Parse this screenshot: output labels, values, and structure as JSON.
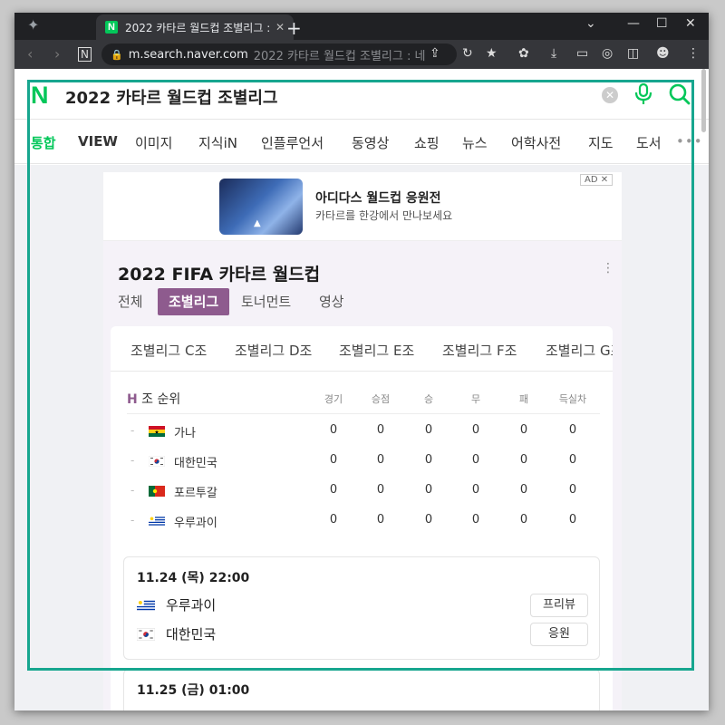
{
  "browser": {
    "tab_title": "2022 카타르 월드컵 조별리그 : ",
    "favicon": "N",
    "url_host": "m.search.naver.com",
    "url_rest": "2022 카타르 월드컵 조별리그 : 네"
  },
  "search": {
    "logo": "N",
    "query": "2022 카타르 월드컵 조별리그"
  },
  "nav": {
    "tabs": [
      "통합",
      "VIEW",
      "이미지",
      "지식iN",
      "인플루언서",
      "동영상",
      "쇼핑",
      "뉴스",
      "어학사전",
      "지도",
      "도서"
    ],
    "active": "통합"
  },
  "ad": {
    "title": "아디다스 월드컵 응원전",
    "desc": "카타르를 한강에서 만나보세요",
    "badge": "AD ✕"
  },
  "worldcup": {
    "title": "2022 FIFA 카타르 월드컵",
    "subtabs": [
      "전체",
      "조별리그",
      "토너먼트",
      "영상"
    ],
    "active_subtab": "조별리그",
    "group_tabs": [
      "조별리그 C조",
      "조별리그 D조",
      "조별리그 E조",
      "조별리그 F조",
      "조별리그 G조"
    ],
    "standings": {
      "group_letter": "H",
      "title_rest": " 조 순위",
      "columns": [
        "경기",
        "승점",
        "승",
        "무",
        "패",
        "득실차"
      ],
      "rows": [
        {
          "team": "가나",
          "values": [
            "0",
            "0",
            "0",
            "0",
            "0",
            "0"
          ]
        },
        {
          "team": "대한민국",
          "values": [
            "0",
            "0",
            "0",
            "0",
            "0",
            "0"
          ]
        },
        {
          "team": "포르투갈",
          "values": [
            "0",
            "0",
            "0",
            "0",
            "0",
            "0"
          ]
        },
        {
          "team": "우루과이",
          "values": [
            "0",
            "0",
            "0",
            "0",
            "0",
            "0"
          ]
        }
      ]
    },
    "matches": [
      {
        "time": "11.24 (목) 22:00",
        "team1": "우루과이",
        "team2": "대한민국",
        "btn1": "프리뷰",
        "btn2": "응원"
      },
      {
        "time": "11.25 (금) 01:00"
      }
    ]
  },
  "colors": {
    "naver_green": "#03c75a",
    "active_purple": "#8e5b8e",
    "annotation_frame": "#17a68f"
  }
}
